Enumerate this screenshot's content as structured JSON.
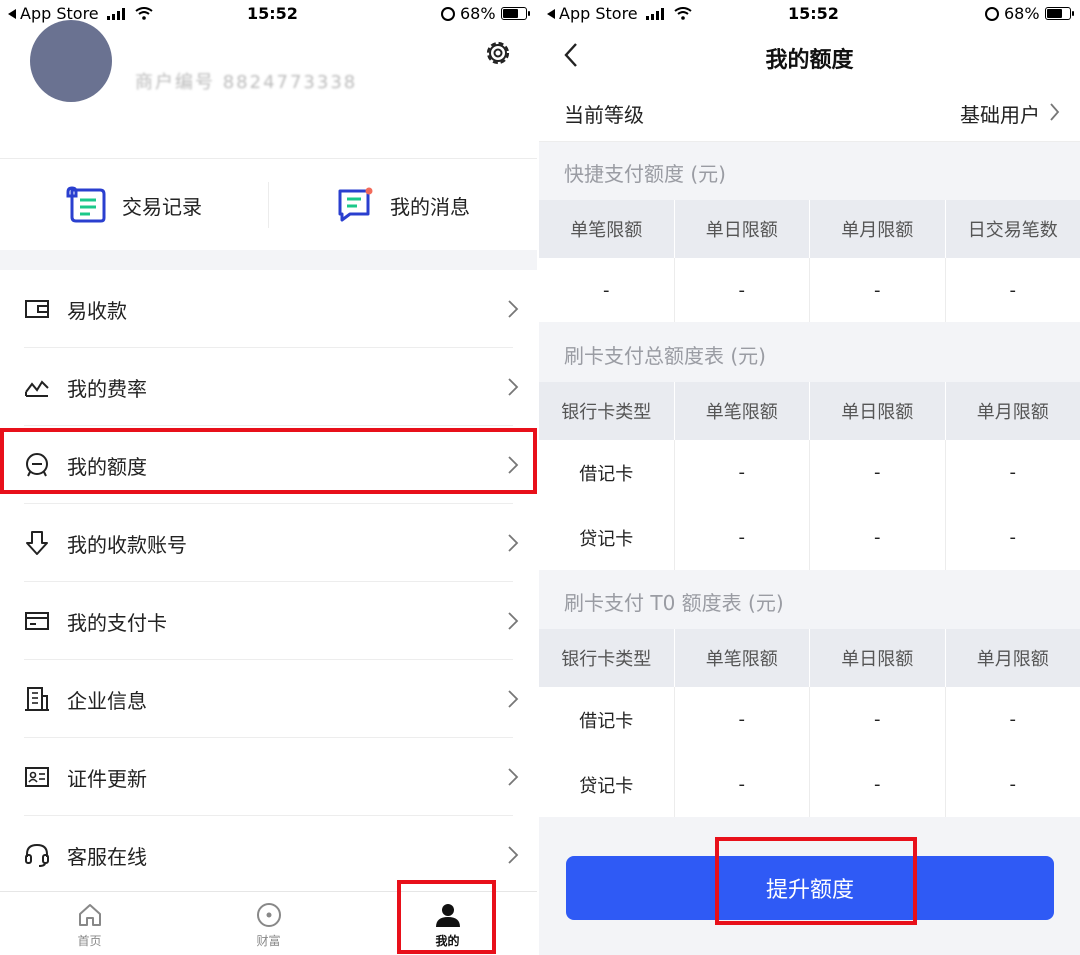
{
  "status_left": {
    "back_app": "App Store",
    "time": "15:52",
    "battery": "68%",
    "battery_level": 0.68
  },
  "status_right": {
    "back_app": "App Store",
    "time": "15:52",
    "battery": "68%",
    "battery_level": 0.68
  },
  "profile": {
    "phone_masked": "商户编号 8824773338"
  },
  "quick_actions": [
    {
      "label": "交易记录",
      "icon": "receipt-scroll-icon"
    },
    {
      "label": "我的消息",
      "icon": "message-icon"
    }
  ],
  "menu": [
    {
      "label": "易收款",
      "icon": "wallet-icon"
    },
    {
      "label": "我的费率",
      "icon": "rate-chart-icon"
    },
    {
      "label": "我的额度",
      "icon": "quota-smile-icon"
    },
    {
      "label": "我的收款账号",
      "icon": "download-arrow-icon"
    },
    {
      "label": "我的支付卡",
      "icon": "card-icon"
    },
    {
      "label": "企业信息",
      "icon": "building-icon"
    },
    {
      "label": "证件更新",
      "icon": "id-card-icon"
    },
    {
      "label": "客服在线",
      "icon": "headset-icon"
    }
  ],
  "tabbar": [
    {
      "label": "首页",
      "icon": "home-icon"
    },
    {
      "label": "财富",
      "icon": "wealth-icon"
    },
    {
      "label": "我的",
      "icon": "user-icon"
    }
  ],
  "quota_page": {
    "title": "我的额度",
    "level_label": "当前等级",
    "level_value": "基础用户",
    "section1": {
      "title": "快捷支付额度 (元)",
      "headers": [
        "单笔限额",
        "单日限额",
        "单月限额",
        "日交易笔数"
      ],
      "rows": [
        [
          "-",
          "-",
          "-",
          "-"
        ]
      ]
    },
    "section2": {
      "title": "刷卡支付总额度表 (元)",
      "headers": [
        "银行卡类型",
        "单笔限额",
        "单日限额",
        "单月限额"
      ],
      "rows": [
        [
          "借记卡",
          "-",
          "-",
          "-"
        ],
        [
          "贷记卡",
          "-",
          "-",
          "-"
        ]
      ]
    },
    "section3": {
      "title": "刷卡支付 T0 额度表 (元)",
      "headers": [
        "银行卡类型",
        "单笔限额",
        "单日限额",
        "单月限额"
      ],
      "rows": [
        [
          "借记卡",
          "-",
          "-",
          "-"
        ],
        [
          "贷记卡",
          "-",
          "-",
          "-"
        ]
      ]
    },
    "cta_label": "提升额度"
  },
  "colors": {
    "accent": "#2f5af5",
    "highlight": "#e8101a",
    "icon_blue": "#2a3fcf",
    "icon_green": "#1bc88a",
    "notify_dot": "#f26b5b"
  }
}
